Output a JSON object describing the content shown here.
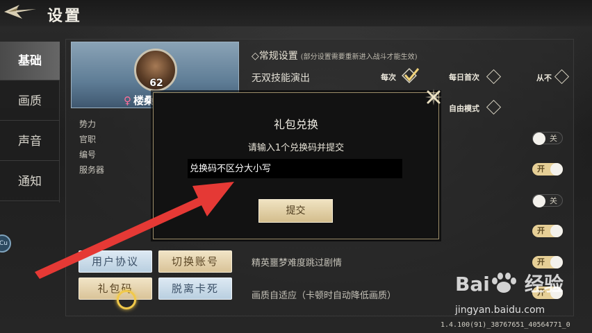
{
  "header": {
    "title": "设置"
  },
  "sidebar": {
    "tabs": [
      {
        "label": "基础",
        "active": true
      },
      {
        "label": "画质",
        "active": false
      },
      {
        "label": "声音",
        "active": false
      },
      {
        "label": "通知",
        "active": false
      }
    ],
    "edge_badge": "Cu"
  },
  "profile": {
    "level": "62",
    "name": "楼桑",
    "gender_icon": "female-icon",
    "info_labels": [
      "势力",
      "官职",
      "编号",
      "服务器"
    ]
  },
  "actions": {
    "user_agreement": "用户协议",
    "switch_account": "切换账号",
    "gift_code": "礼包码",
    "unstuck": "脱离卡死"
  },
  "settings": {
    "header": "◇常规设置",
    "header_note": "(部分设置需要重新进入战斗才能生效)",
    "musou_label": "无双技能演出",
    "musou_options": {
      "every_time": "每次",
      "daily_first": "每日首次",
      "never": "从不",
      "free_mode": "自由模式",
      "selected": "every_time"
    },
    "elite_label": "精英噩梦难度跳过剧情",
    "adapt_label": "画质自适应（卡顿时自动降低画质）",
    "toggles": [
      {
        "state": "off",
        "label": "关"
      },
      {
        "state": "on",
        "label": "开"
      },
      {
        "state": "off",
        "label": "关"
      },
      {
        "state": "on",
        "label": "开"
      },
      {
        "state": "on",
        "label": "开"
      },
      {
        "state": "on",
        "label": "开"
      }
    ]
  },
  "modal": {
    "title": "礼包兑换",
    "prompt": "请输入1个兑换码并提交",
    "input_value": "",
    "input_placeholder": "兑换码不区分大小写",
    "submit_label": "提交"
  },
  "watermark": {
    "brand_left": "Bai",
    "brand_right": "经验",
    "url": "jingyan.baidu.com"
  },
  "version": "1.4.100(91)_38767651_40564771_0",
  "colors": {
    "accent_gold": "#e6cf96",
    "modal_border": "#9e8f6a",
    "arrow_red": "#e53935",
    "highlight_ring": "#f1c94a"
  }
}
